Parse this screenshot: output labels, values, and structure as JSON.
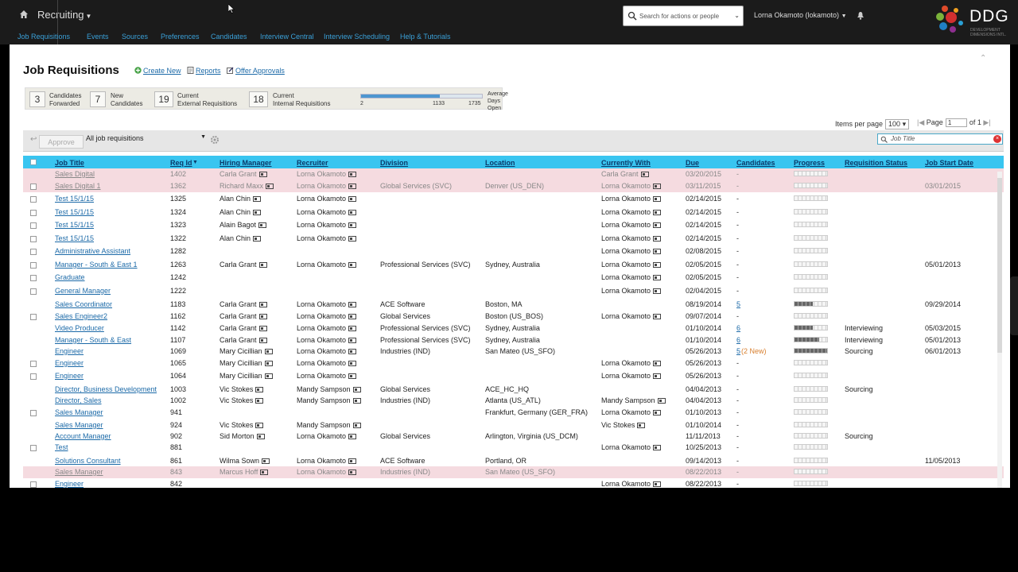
{
  "app": {
    "title": "Recruiting",
    "search_placeholder": "Search for actions or people",
    "user": "Lorna Okamoto (lokamoto)",
    "logo": "DDG",
    "logo_tagline": "DEVELOPMENT DIMENSIONS INTL."
  },
  "nav": [
    "Job Requisitions",
    "Events",
    "Sources",
    "Preferences",
    "Candidates",
    "Interview Central",
    "Interview Scheduling",
    "Help & Tutorials"
  ],
  "page": {
    "title": "Job Requisitions",
    "actions": [
      "Create New",
      "Reports",
      "Offer Approvals"
    ]
  },
  "stats": [
    {
      "value": "3",
      "label1": "Candidates",
      "label2": "Forwarded"
    },
    {
      "value": "7",
      "label1": "New",
      "label2": "Candidates"
    },
    {
      "value": "19",
      "label1": "Current",
      "label2": "External Requisitions"
    },
    {
      "value": "18",
      "label1": "Current",
      "label2": "Internal Requisitions"
    }
  ],
  "gauge": {
    "min": "2",
    "mid": "1133",
    "max": "1735",
    "fill_fraction": 0.65,
    "label1": "Average",
    "label2": "Days Open"
  },
  "paging": {
    "items_label": "Items per page",
    "items_value": "100",
    "page_label": "Page",
    "page_value": "1",
    "of_label": "of 1"
  },
  "toolbar": {
    "approve": "Approve",
    "filter": "All job requisitions",
    "job_search_placeholder": "Job Title"
  },
  "columns": [
    "Job Title",
    "Req Id",
    "Hiring Manager",
    "Recruiter",
    "Division",
    "Location",
    "Currently With",
    "Due",
    "Candidates",
    "Progress",
    "Requisition Status",
    "Job Start Date"
  ],
  "rows": [
    {
      "title": "Sales Digital",
      "id": "1402",
      "hm": "Carla Grant",
      "rec": "Lorna Okamoto",
      "div": "",
      "loc": "",
      "with": "Carla Grant",
      "due": "03/20/2015",
      "cand": "-",
      "prog": 0,
      "status": "",
      "start": "",
      "hl": true,
      "dim": true,
      "chk": false
    },
    {
      "title": "Sales Digital 1",
      "id": "1362",
      "hm": "Richard Maxx",
      "rec": "Lorna Okamoto",
      "div": "Global Services (SVC)",
      "loc": "Denver (US_DEN)",
      "with": "Lorna Okamoto",
      "due": "03/11/2015",
      "cand": "-",
      "prog": 0,
      "status": "",
      "start": "03/01/2015",
      "hl": true,
      "dim": true,
      "chk": true
    },
    {
      "title": "Test 15/1/15",
      "id": "1325",
      "hm": "Alan Chin",
      "rec": "Lorna Okamoto",
      "div": "",
      "loc": "",
      "with": "Lorna Okamoto",
      "due": "02/14/2015",
      "cand": "-",
      "prog": 0,
      "status": "",
      "start": "",
      "chk": true
    },
    {
      "title": "Test 15/1/15",
      "id": "1324",
      "hm": "Alan Chin",
      "rec": "Lorna Okamoto",
      "div": "",
      "loc": "",
      "with": "Lorna Okamoto",
      "due": "02/14/2015",
      "cand": "-",
      "prog": 0,
      "status": "",
      "start": "",
      "chk": true
    },
    {
      "title": "Test 15/1/15",
      "id": "1323",
      "hm": "Alain Bagot",
      "rec": "Lorna Okamoto",
      "div": "",
      "loc": "",
      "with": "Lorna Okamoto",
      "due": "02/14/2015",
      "cand": "-",
      "prog": 0,
      "status": "",
      "start": "",
      "chk": true
    },
    {
      "title": "Test 15/1/15",
      "id": "1322",
      "hm": "Alan Chin",
      "rec": "Lorna Okamoto",
      "div": "",
      "loc": "",
      "with": "Lorna Okamoto",
      "due": "02/14/2015",
      "cand": "-",
      "prog": 0,
      "status": "",
      "start": "",
      "chk": true
    },
    {
      "title": "Administrative Assistant",
      "id": "1282",
      "hm": "",
      "rec": "",
      "div": "",
      "loc": "",
      "with": "Lorna Okamoto",
      "due": "02/08/2015",
      "cand": "-",
      "prog": 0,
      "status": "",
      "start": "",
      "chk": true
    },
    {
      "title": "Manager - South & East 1",
      "id": "1263",
      "hm": "Carla Grant",
      "rec": "Lorna Okamoto",
      "div": "Professional Services (SVC)",
      "loc": "Sydney, Australia",
      "with": "Lorna Okamoto",
      "due": "02/05/2015",
      "cand": "-",
      "prog": 0,
      "status": "",
      "start": "05/01/2013",
      "chk": true
    },
    {
      "title": "Graduate",
      "id": "1242",
      "hm": "",
      "rec": "",
      "div": "",
      "loc": "",
      "with": "Lorna Okamoto",
      "due": "02/05/2015",
      "cand": "-",
      "prog": 0,
      "status": "",
      "start": "",
      "chk": true
    },
    {
      "title": "General Manager",
      "id": "1222",
      "hm": "",
      "rec": "",
      "div": "",
      "loc": "",
      "with": "Lorna Okamoto",
      "due": "02/04/2015",
      "cand": "-",
      "prog": 0,
      "status": "",
      "start": "",
      "chk": true
    },
    {
      "title": "Sales Coordinator",
      "id": "1183",
      "hm": "Carla Grant",
      "rec": "Lorna Okamoto",
      "div": "ACE Software",
      "loc": "Boston, MA",
      "with": "",
      "due": "08/19/2014",
      "cand": "5",
      "prog": 0.55,
      "status": "",
      "start": "09/29/2014",
      "chk": false
    },
    {
      "title": "Sales Engineer2",
      "id": "1162",
      "hm": "Carla Grant",
      "rec": "Lorna Okamoto",
      "div": "Global Services",
      "loc": "Boston (US_BOS)",
      "with": "Lorna Okamoto",
      "due": "09/07/2014",
      "cand": "-",
      "prog": 0,
      "status": "",
      "start": "",
      "chk": true
    },
    {
      "title": "Video Producer",
      "id": "1142",
      "hm": "Carla Grant",
      "rec": "Lorna Okamoto",
      "div": "Professional Services (SVC)",
      "loc": "Sydney, Australia",
      "with": "",
      "due": "01/10/2014",
      "cand": "6",
      "prog": 0.55,
      "status": "Interviewing",
      "start": "05/03/2015",
      "chk": false
    },
    {
      "title": "Manager - South & East",
      "id": "1107",
      "hm": "Carla Grant",
      "rec": "Lorna Okamoto",
      "div": "Professional Services (SVC)",
      "loc": "Sydney, Australia",
      "with": "",
      "due": "01/10/2014",
      "cand": "6",
      "prog": 0.75,
      "status": "Interviewing",
      "start": "05/01/2013",
      "chk": false
    },
    {
      "title": "Engineer",
      "id": "1069",
      "hm": "Mary Cicillian",
      "rec": "Lorna Okamoto",
      "div": "Industries (IND)",
      "loc": "San Mateo (US_SFO)",
      "with": "",
      "due": "05/26/2013",
      "cand": "5",
      "new": "(2 New)",
      "prog": 1,
      "status": "Sourcing",
      "start": "06/01/2013",
      "chk": false
    },
    {
      "title": "Engineer",
      "id": "1065",
      "hm": "Mary Cicillian",
      "rec": "Lorna Okamoto",
      "div": "",
      "loc": "",
      "with": "Lorna Okamoto",
      "due": "05/26/2013",
      "cand": "-",
      "prog": 0,
      "status": "",
      "start": "",
      "chk": true
    },
    {
      "title": "Engineer",
      "id": "1064",
      "hm": "Mary Cicillian",
      "rec": "Lorna Okamoto",
      "div": "",
      "loc": "",
      "with": "Lorna Okamoto",
      "due": "05/26/2013",
      "cand": "-",
      "prog": 0,
      "status": "",
      "start": "",
      "chk": true
    },
    {
      "title": "Director, Business Development",
      "id": "1003",
      "hm": "Vic Stokes",
      "rec": "Mandy Sampson",
      "div": "Global Services",
      "loc": "ACE_HC_HQ",
      "with": "",
      "due": "04/04/2013",
      "cand": "-",
      "prog": 0,
      "status": "Sourcing",
      "start": "",
      "chk": false
    },
    {
      "title": "Director, Sales",
      "id": "1002",
      "hm": "Vic Stokes",
      "rec": "Mandy Sampson",
      "div": "Industries (IND)",
      "loc": "Atlanta (US_ATL)",
      "with": "Mandy Sampson",
      "due": "04/04/2013",
      "cand": "-",
      "prog": 0,
      "status": "",
      "start": "",
      "chk": false
    },
    {
      "title": "Sales Manager",
      "id": "941",
      "hm": "",
      "rec": "",
      "div": "",
      "loc": "Frankfurt, Germany (GER_FRA)",
      "with": "Lorna Okamoto",
      "due": "01/10/2013",
      "cand": "-",
      "prog": 0,
      "status": "",
      "start": "",
      "chk": true
    },
    {
      "title": "Sales Manager",
      "id": "924",
      "hm": "Vic Stokes",
      "rec": "Mandy Sampson",
      "div": "",
      "loc": "",
      "with": "Vic Stokes",
      "due": "01/10/2014",
      "cand": "-",
      "prog": 0,
      "status": "",
      "start": "",
      "chk": false
    },
    {
      "title": "Account Manager",
      "id": "902",
      "hm": "Sid Morton",
      "rec": "Lorna Okamoto",
      "div": "Global Services",
      "loc": "Arlington, Virginia (US_DCM)",
      "with": "",
      "due": "11/11/2013",
      "cand": "-",
      "prog": 0,
      "status": "Sourcing",
      "start": "",
      "chk": false
    },
    {
      "title": "Test",
      "id": "881",
      "hm": "",
      "rec": "",
      "div": "",
      "loc": "",
      "with": "Lorna Okamoto",
      "due": "10/25/2013",
      "cand": "-",
      "prog": 0,
      "status": "",
      "start": "",
      "chk": true
    },
    {
      "title": "Solutions Consultant",
      "id": "861",
      "hm": "Wilma Sown",
      "rec": "Lorna Okamoto",
      "div": "ACE Software",
      "loc": "Portland, OR",
      "with": "",
      "due": "09/14/2013",
      "cand": "-",
      "prog": 0,
      "status": "",
      "start": "11/05/2013",
      "chk": false
    },
    {
      "title": "Sales Manager",
      "id": "843",
      "hm": "Marcus Hoff",
      "rec": "Lorna Okamoto",
      "div": "Industries (IND)",
      "loc": "San Mateo (US_SFO)",
      "with": "",
      "due": "08/22/2013",
      "cand": "-",
      "prog": 0,
      "status": "",
      "start": "",
      "hl": true,
      "dim": true,
      "chk": false
    },
    {
      "title": "Engineer",
      "id": "842",
      "hm": "",
      "rec": "",
      "div": "",
      "loc": "",
      "with": "Lorna Okamoto",
      "due": "08/22/2013",
      "cand": "-",
      "prog": 0,
      "status": "",
      "start": "",
      "chk": true
    }
  ]
}
